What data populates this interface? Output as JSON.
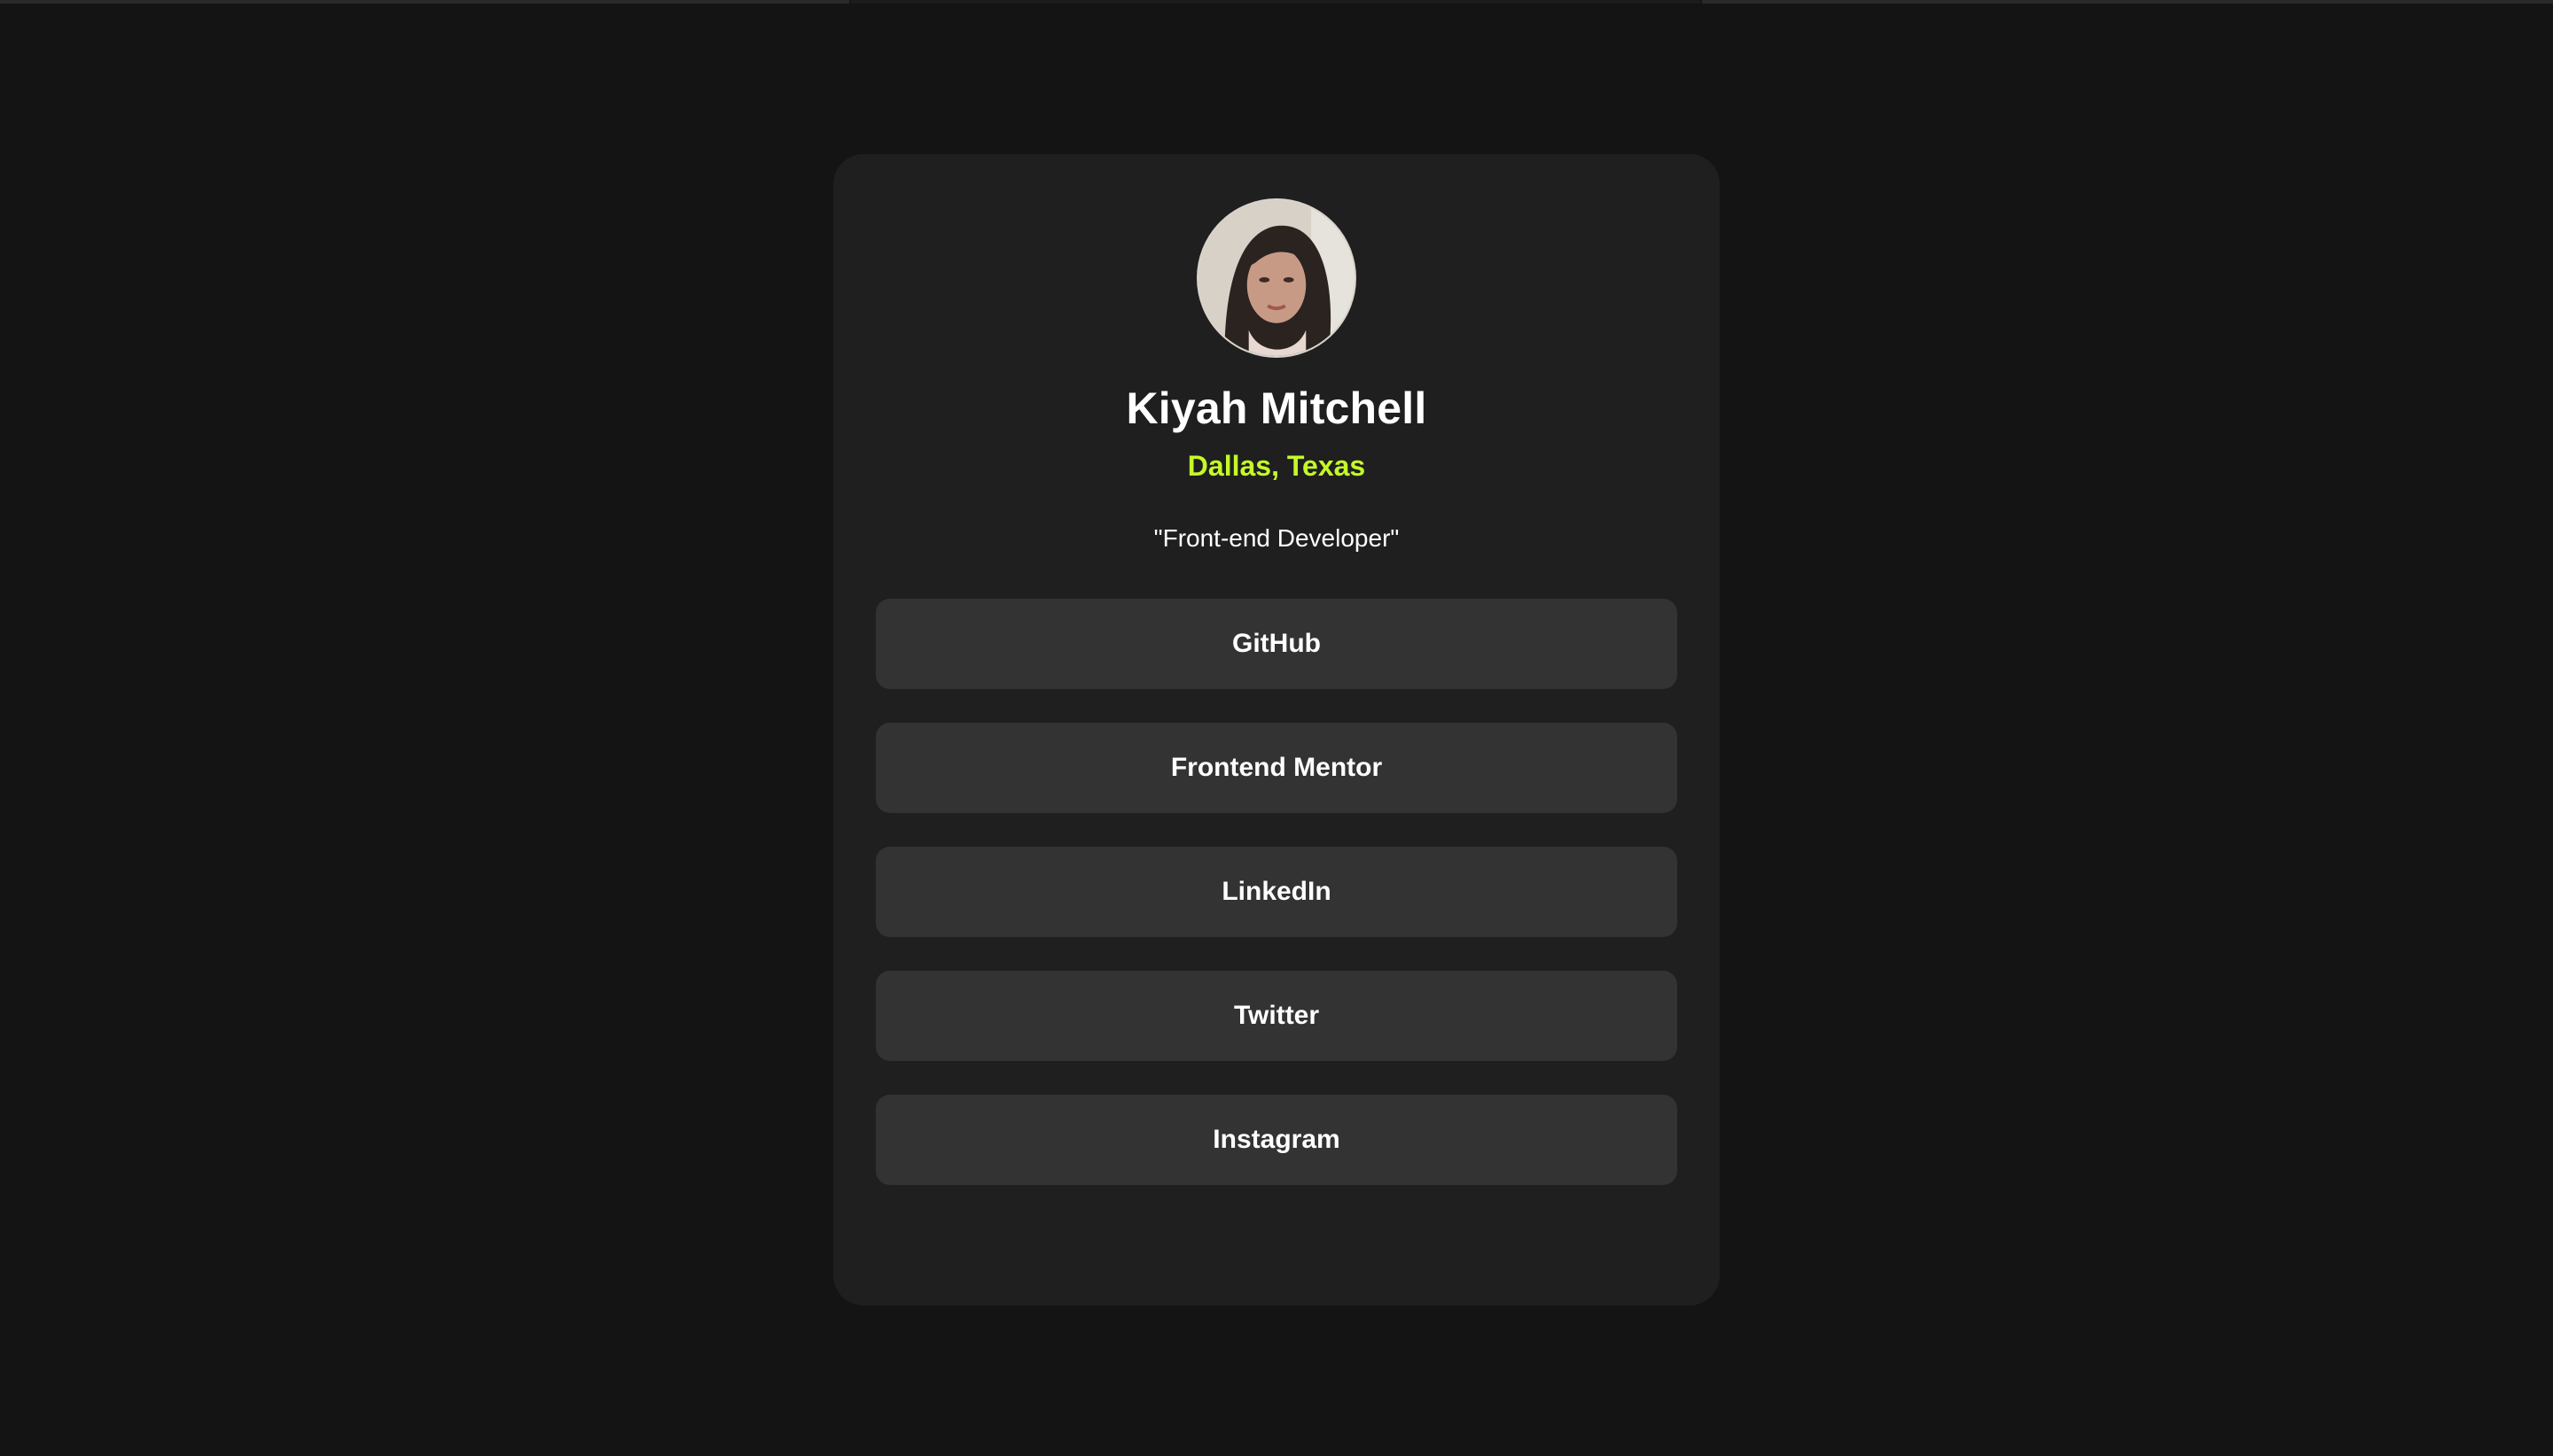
{
  "profile": {
    "name": "Kiyah Mitchell",
    "location": "Dallas, Texas",
    "bio": "\"Front-end Developer\"",
    "avatar_icon": "profile-photo"
  },
  "links": [
    {
      "label": "GitHub"
    },
    {
      "label": "Frontend Mentor"
    },
    {
      "label": "LinkedIn"
    },
    {
      "label": "Twitter"
    },
    {
      "label": "Instagram"
    }
  ],
  "colors": {
    "background": "#141414",
    "card": "#1f1f1f",
    "button": "#333333",
    "accent": "#c4f82a",
    "text": "#ffffff"
  }
}
